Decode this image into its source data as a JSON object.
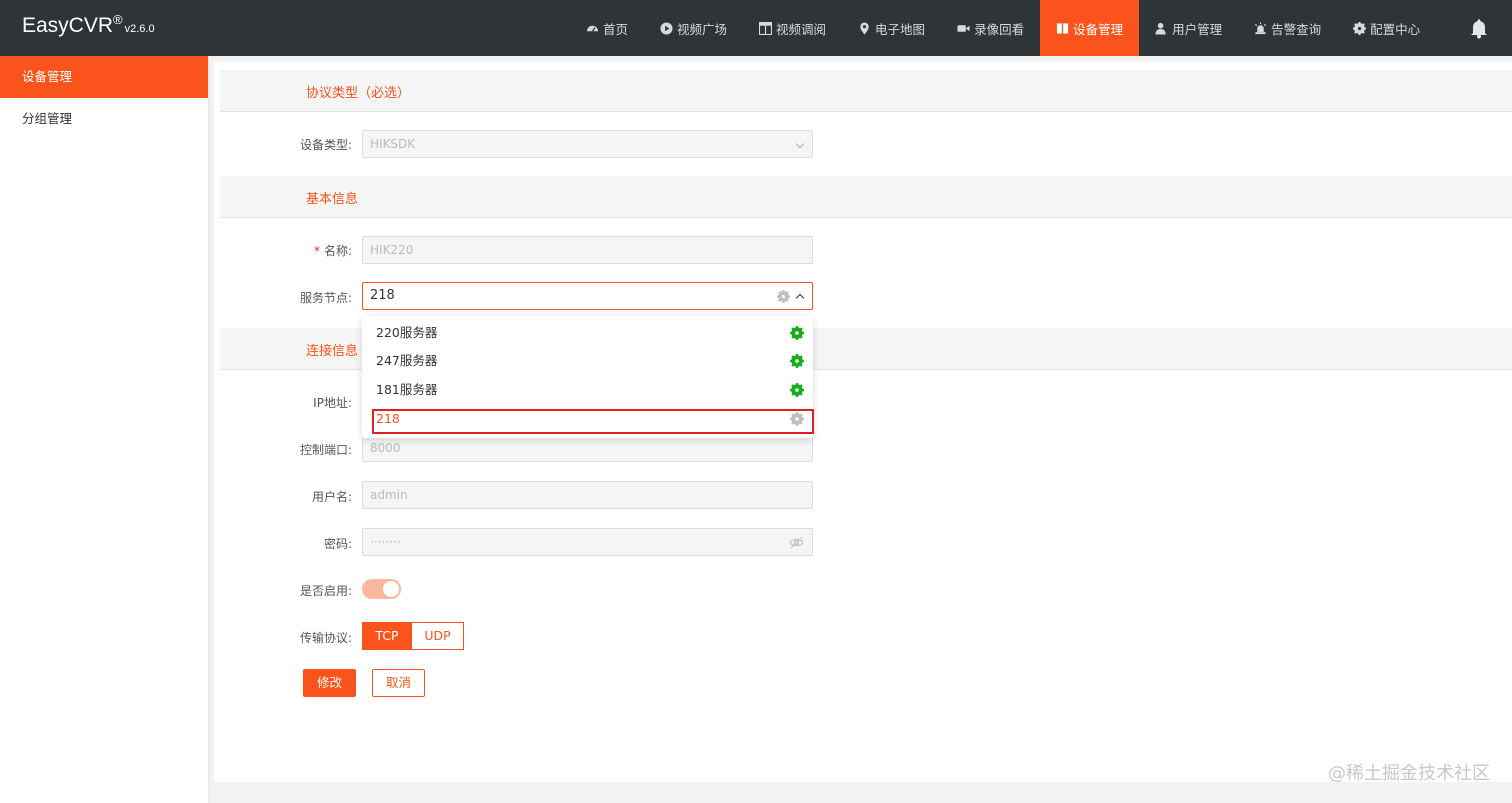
{
  "header": {
    "logo": "EasyCVR",
    "logo_mark": "®",
    "version": "v2.6.0",
    "nav": [
      {
        "label": "首页",
        "icon": "dashboard-icon"
      },
      {
        "label": "视频广场",
        "icon": "play-circle-icon"
      },
      {
        "label": "视频调阅",
        "icon": "grid-icon"
      },
      {
        "label": "电子地图",
        "icon": "map-pin-icon"
      },
      {
        "label": "录像回看",
        "icon": "video-camera-icon"
      },
      {
        "label": "设备管理",
        "icon": "book-icon",
        "active": true
      },
      {
        "label": "用户管理",
        "icon": "user-icon"
      },
      {
        "label": "告警查询",
        "icon": "alarm-icon"
      },
      {
        "label": "配置中心",
        "icon": "gear-icon"
      }
    ]
  },
  "sidebar": {
    "items": [
      {
        "label": "设备管理",
        "active": true
      },
      {
        "label": "分组管理"
      }
    ]
  },
  "form": {
    "protocol_section": "协议类型（必选）",
    "device_type_label": "设备类型:",
    "device_type_value": "HIKSDK",
    "basic_section": "基本信息",
    "name_required": "*",
    "name_label": "名称:",
    "name_value": "HIK220",
    "node_label": "服务节点:",
    "node_value": "218",
    "connect_section": "连接信息",
    "ip_label": "IP地址:",
    "port_label": "控制端口:",
    "port_value": "8000",
    "username_label": "用户名:",
    "username_value": "admin",
    "password_label": "密码:",
    "password_value": "········",
    "enabled_label": "是否启用:",
    "enabled": true,
    "transport_label": "传输协议:",
    "transport_options": [
      "TCP",
      "UDP"
    ],
    "transport_selected": "TCP",
    "submit": "修改",
    "cancel": "取消"
  },
  "dropdown": {
    "options": [
      {
        "label": "220服务器",
        "status": "online"
      },
      {
        "label": "247服务器",
        "status": "online"
      },
      {
        "label": "181服务器",
        "status": "online"
      },
      {
        "label": "218",
        "status": "offline",
        "selected": true
      }
    ]
  },
  "colors": {
    "accent": "#fa541c",
    "topbar": "#2f3439",
    "online": "#1aad19",
    "offline": "#bfbfbf",
    "highlight_box": "#e02020"
  },
  "watermark": "@稀土掘金技术社区"
}
